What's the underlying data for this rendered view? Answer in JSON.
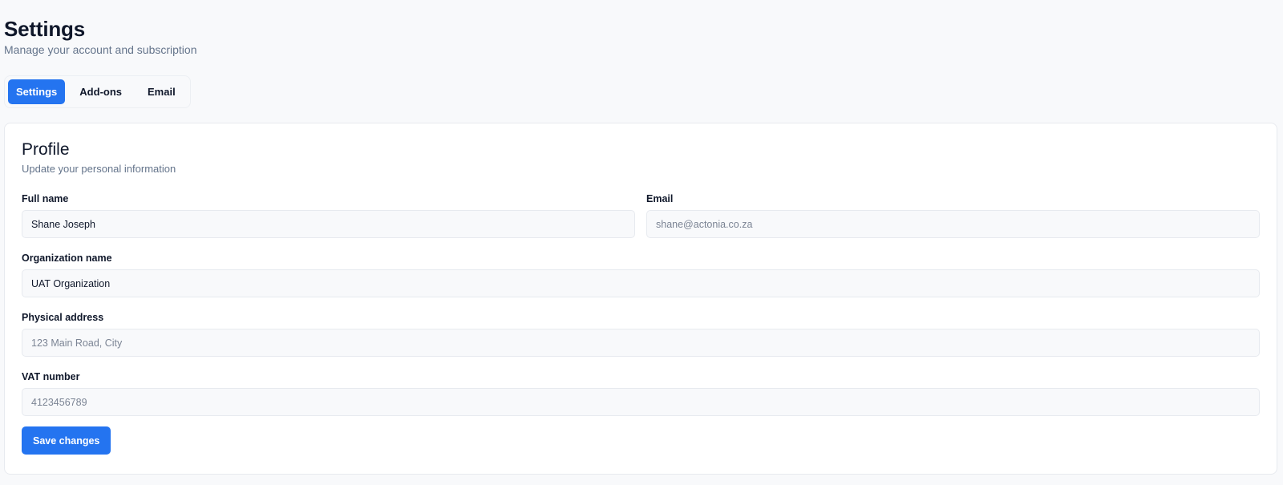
{
  "header": {
    "title": "Settings",
    "subtitle": "Manage your account and subscription"
  },
  "tabs": [
    {
      "label": "Settings",
      "active": true
    },
    {
      "label": "Add-ons",
      "active": false
    },
    {
      "label": "Email",
      "active": false
    }
  ],
  "profile": {
    "title": "Profile",
    "subtitle": "Update your personal information",
    "full_name": {
      "label": "Full name",
      "value": "Shane Joseph"
    },
    "email": {
      "label": "Email",
      "value": "shane@actonia.co.za"
    },
    "organization": {
      "label": "Organization name",
      "value": "UAT Organization"
    },
    "address": {
      "label": "Physical address",
      "placeholder": "123 Main Road, City"
    },
    "vat": {
      "label": "VAT number",
      "placeholder": "4123456789"
    },
    "save_label": "Save changes"
  },
  "colors": {
    "accent": "#2474f0",
    "muted_text": "#64748b"
  }
}
